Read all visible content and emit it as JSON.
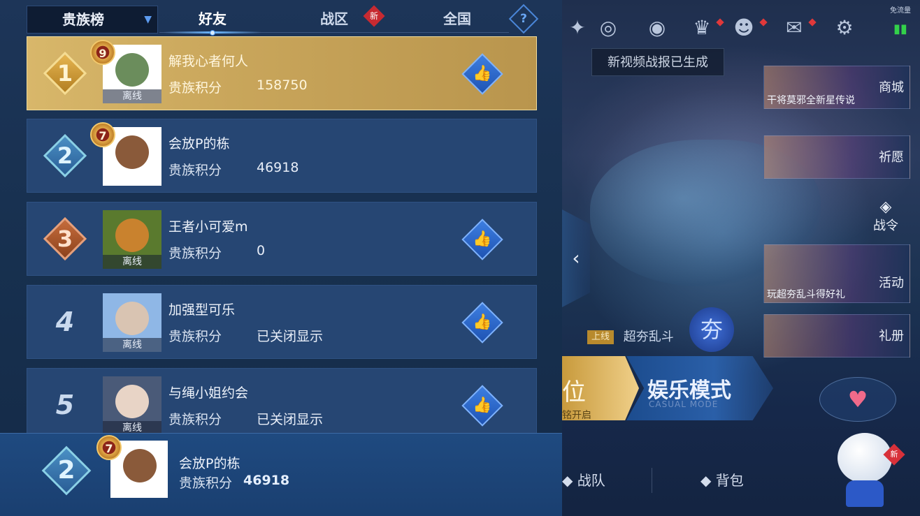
{
  "panel": {
    "tab_select": "贵族榜",
    "tabs": [
      {
        "label": "好友",
        "active": true
      },
      {
        "label": "战区",
        "badge": "新"
      },
      {
        "label": "全国"
      }
    ],
    "help": "?"
  },
  "rows": [
    {
      "rank": "1",
      "level": "9",
      "name": "解我心者何人",
      "score_label": "贵族积分",
      "score": "158750",
      "status": "离线",
      "like": true
    },
    {
      "rank": "2",
      "level": "7",
      "name": "会放P的栋",
      "score_label": "贵族积分",
      "score": "46918",
      "status": "",
      "like": false
    },
    {
      "rank": "3",
      "level": "",
      "name": "王者小可爱m",
      "score_label": "贵族积分",
      "score": "0",
      "status": "离线",
      "like": true
    },
    {
      "rank": "4",
      "level": "",
      "name": "加强型可乐",
      "score_label": "贵族积分",
      "score": "已关闭显示",
      "status": "离线",
      "like": true
    },
    {
      "rank": "5",
      "level": "",
      "name": "与绳小姐约会",
      "score_label": "贵族积分",
      "score": "已关闭显示",
      "status": "离线",
      "like": true
    }
  ],
  "me": {
    "rank": "2",
    "level": "7",
    "name": "会放P的栋",
    "score_label": "贵族积分",
    "score": "46918"
  },
  "lobby": {
    "network": "免流量",
    "toast": "新视频战报已生成",
    "cards": [
      {
        "label": "商城",
        "caption": "干将莫邪全新星传说"
      },
      {
        "label": "祈愿",
        "caption": ""
      },
      {
        "label": "活动",
        "caption": "玩超夯乱斗得好礼"
      },
      {
        "label": "礼册",
        "caption": ""
      }
    ],
    "battle_pass": "战令",
    "event_tag": "上线",
    "event_name": "超夯乱斗",
    "kua": "夯",
    "rank_mode": "位",
    "rank_mode_sub": "铭开启",
    "casual_mode": "娱乐模式",
    "casual_mode_en": "CASUAL MODE",
    "nav_team": "战队",
    "nav_bag": "背包",
    "mascot_badge": "新"
  },
  "colors": {
    "accent": "#3d7ee0",
    "gold_row": "#c9a65b",
    "row_bg": "#264673"
  }
}
